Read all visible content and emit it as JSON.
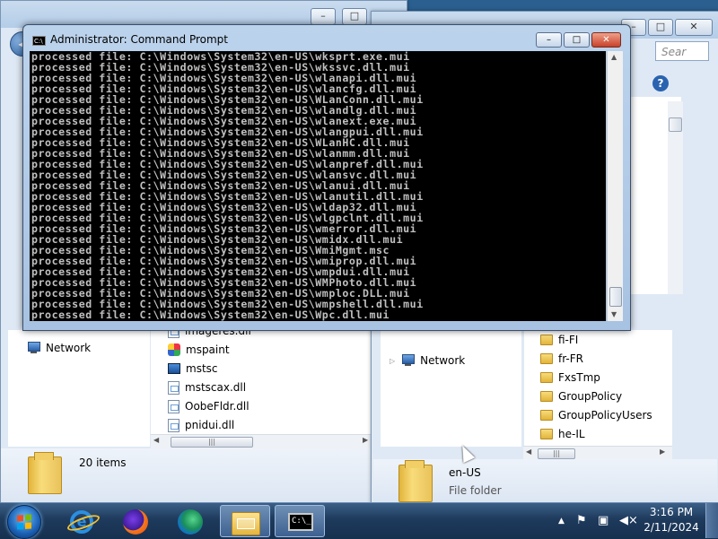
{
  "cmd_window": {
    "title": "Administrator: Command Prompt",
    "icon": "C:\\",
    "minimize_label": "–",
    "maximize_label": "□",
    "close_label": "✕",
    "lines": [
      "processed file: C:\\Windows\\System32\\en-US\\wksprt.exe.mui",
      "processed file: C:\\Windows\\System32\\en-US\\wkssvc.dll.mui",
      "processed file: C:\\Windows\\System32\\en-US\\wlanapi.dll.mui",
      "processed file: C:\\Windows\\System32\\en-US\\wlancfg.dll.mui",
      "processed file: C:\\Windows\\System32\\en-US\\WLanConn.dll.mui",
      "processed file: C:\\Windows\\System32\\en-US\\wlandlg.dll.mui",
      "processed file: C:\\Windows\\System32\\en-US\\wlanext.exe.mui",
      "processed file: C:\\Windows\\System32\\en-US\\wlangpui.dll.mui",
      "processed file: C:\\Windows\\System32\\en-US\\WLanHC.dll.mui",
      "processed file: C:\\Windows\\System32\\en-US\\wlanmm.dll.mui",
      "processed file: C:\\Windows\\System32\\en-US\\wlanpref.dll.mui",
      "processed file: C:\\Windows\\System32\\en-US\\wlansvc.dll.mui",
      "processed file: C:\\Windows\\System32\\en-US\\wlanui.dll.mui",
      "processed file: C:\\Windows\\System32\\en-US\\wlanutil.dll.mui",
      "processed file: C:\\Windows\\System32\\en-US\\wldap32.dll.mui",
      "processed file: C:\\Windows\\System32\\en-US\\wlgpclnt.dll.mui",
      "processed file: C:\\Windows\\System32\\en-US\\wmerror.dll.mui",
      "processed file: C:\\Windows\\System32\\en-US\\wmidx.dll.mui",
      "processed file: C:\\Windows\\System32\\en-US\\WmiMgmt.msc",
      "processed file: C:\\Windows\\System32\\en-US\\wmiprop.dll.mui",
      "processed file: C:\\Windows\\System32\\en-US\\wmpdui.dll.mui",
      "processed file: C:\\Windows\\System32\\en-US\\WMPhoto.dll.mui",
      "processed file: C:\\Windows\\System32\\en-US\\wmploc.DLL.mui",
      "processed file: C:\\Windows\\System32\\en-US\\wmpshell.dll.mui",
      "processed file: C:\\Windows\\System32\\en-US\\Wpc.dll.mui"
    ]
  },
  "explorer_left": {
    "nav_network": "Network",
    "files": [
      {
        "name": "imageres.dll",
        "icon": "dll-file-icon"
      },
      {
        "name": "mspaint",
        "icon": "paint-app-icon"
      },
      {
        "name": "mstsc",
        "icon": "remote-desktop-icon"
      },
      {
        "name": "mstscax.dll",
        "icon": "dll-file-icon"
      },
      {
        "name": "OobeFldr.dll",
        "icon": "dll-file-icon"
      },
      {
        "name": "pnidui.dll",
        "icon": "dll-file-icon"
      }
    ],
    "status_count": "20 items"
  },
  "explorer_right": {
    "search_placeholder": "Sear",
    "help_label": "?",
    "nav_network": "Network",
    "folders": [
      "fi-FI",
      "fr-FR",
      "FxsTmp",
      "GroupPolicy",
      "GroupPolicyUsers",
      "he-IL"
    ],
    "selected_name": "en-US",
    "selected_type": "File folder"
  },
  "taskbar": {
    "clock_time": "3:16 PM",
    "clock_date": "2/11/2024",
    "cmd_icon_text": "C:\\_"
  }
}
